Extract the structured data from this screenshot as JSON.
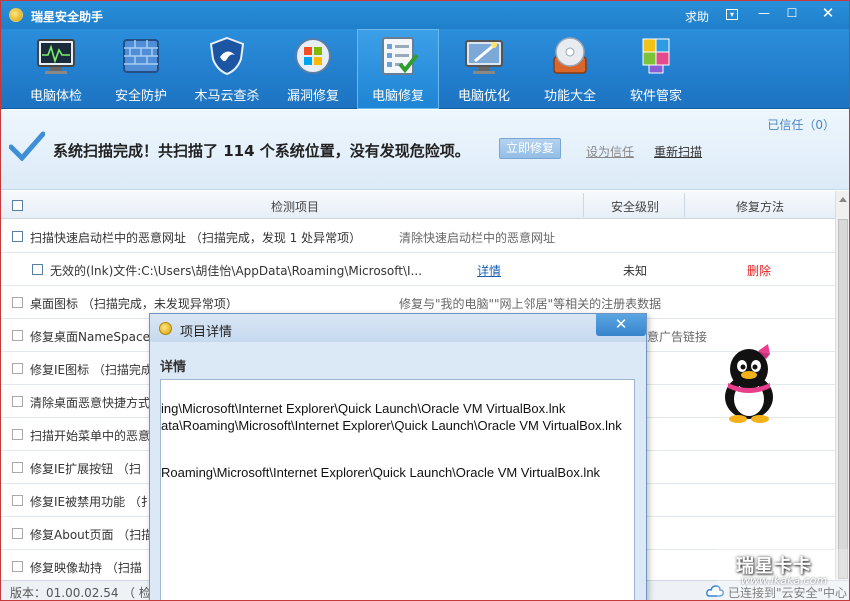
{
  "window": {
    "title": "瑞星安全助手",
    "help": "求助",
    "menu_icon": "menu-icon",
    "min_icon": "minimize-icon",
    "max_icon": "maximize-icon",
    "close_icon": "close-icon",
    "close_symbol": "✕",
    "min_symbol": "—",
    "max_symbol": "☐",
    "menu_symbol": "▾"
  },
  "toolbar": {
    "items": [
      {
        "label": "电脑体检",
        "icon": "monitor-pulse-icon"
      },
      {
        "label": "安全防护",
        "icon": "firewall-icon"
      },
      {
        "label": "木马云查杀",
        "icon": "shield-icon"
      },
      {
        "label": "漏洞修复",
        "icon": "windows-patch-icon"
      },
      {
        "label": "电脑修复",
        "icon": "checklist-icon",
        "active": true
      },
      {
        "label": "电脑优化",
        "icon": "magic-wand-monitor-icon"
      },
      {
        "label": "功能大全",
        "icon": "disc-box-icon"
      },
      {
        "label": "软件管家",
        "icon": "software-blocks-icon"
      }
    ]
  },
  "status": {
    "trusted": "已信任（0）",
    "message": "系统扫描完成！共扫描了 114 个系统位置，没有发现危险项。",
    "fix_now": "立即修复",
    "set_trust": "设为信任",
    "rescan": "重新扫描"
  },
  "table": {
    "headers": {
      "items": "检测项目",
      "level": "安全级别",
      "method": "修复方法"
    },
    "rows": [
      {
        "name": "扫描快速启动栏中的恶意网址 （扫描完成，发现 1 处异常项）",
        "desc": "清除快速启动栏中的恶意网址"
      },
      {
        "name": "无效的(lnk)文件:C:\\Users\\胡佳怡\\AppData\\Roaming\\Microsoft\\I...",
        "detail": "详情",
        "level": "未知",
        "method": "删除",
        "sub": true
      },
      {
        "name": "桌面图标 （扫描完成，未发现异常项）",
        "desc": "修复与\"我的电脑\"\"网上邻居\"等相关的注册表数据"
      },
      {
        "name": "修复桌面NameSpace",
        "desc": "意广告链接"
      },
      {
        "name": "修复IE图标 （扫描完成",
        "desc": ""
      },
      {
        "name": "清除桌面恶意快捷方式",
        "desc": ""
      },
      {
        "name": "扫描开始菜单中的恶意",
        "desc": ""
      },
      {
        "name": "修复IE扩展按钮 （扫",
        "desc": ""
      },
      {
        "name": "修复IE被禁用功能 （扌",
        "desc": ""
      },
      {
        "name": "修复About页面 （扫描",
        "desc": ""
      },
      {
        "name": "修复映像劫持 （扫描",
        "desc": ""
      }
    ]
  },
  "footer": {
    "version": "版本：01.00.02.54",
    "check": "（ 检",
    "cloud_status": "已连接到\"云安全\"中心"
  },
  "watermark": {
    "title": "瑞星卡卡",
    "url": "www.ikaka.com"
  },
  "dialog": {
    "title": "项目详情",
    "label": "详情",
    "close": "✕",
    "lines": [
      "ing\\Microsoft\\Internet Explorer\\Quick Launch\\Oracle VM VirtualBox.lnk",
      "ata\\Roaming\\Microsoft\\Internet Explorer\\Quick Launch\\Oracle VM VirtualBox.lnk",
      "Roaming\\Microsoft\\Internet Explorer\\Quick Launch\\Oracle VM VirtualBox.lnk"
    ]
  },
  "colors": {
    "titlebar": "#2a8fd8",
    "delete": "#e02020",
    "link": "#1a5fb4"
  }
}
